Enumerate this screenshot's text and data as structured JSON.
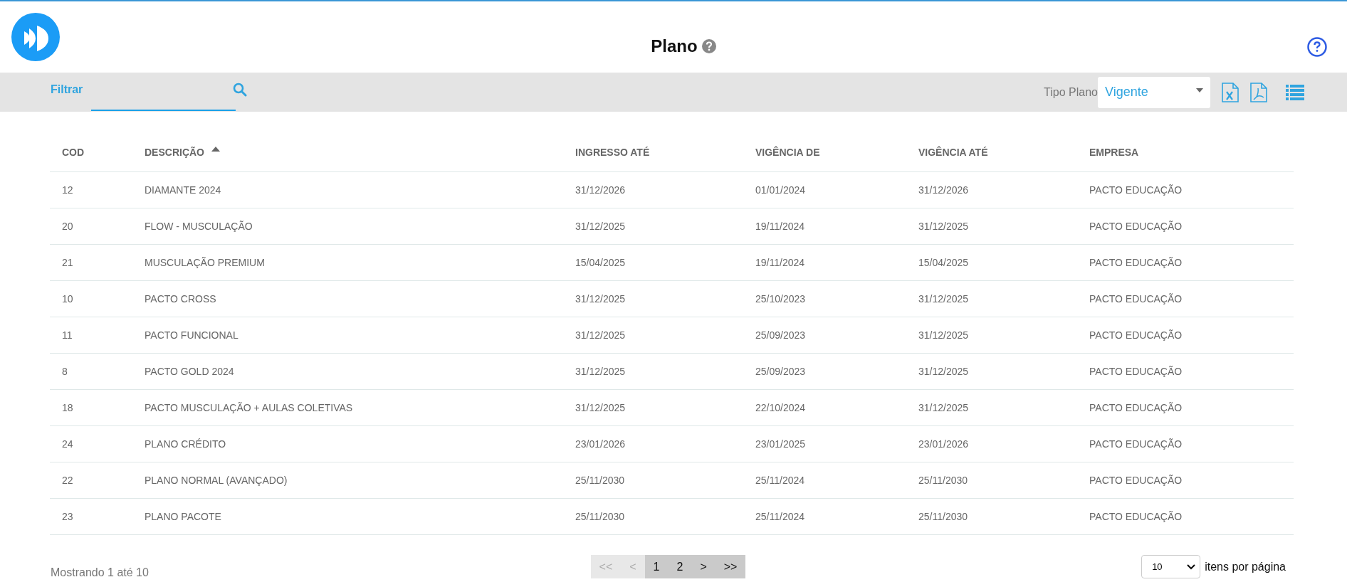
{
  "header": {
    "title": "Plano"
  },
  "filter_bar": {
    "filter_label": "Filtrar",
    "type_label": "Tipo Plano",
    "type_select": {
      "value": "Vigente"
    }
  },
  "table": {
    "columns": [
      {
        "label": "COD",
        "sorted": false
      },
      {
        "label": "DESCRIÇÃO",
        "sorted": true
      },
      {
        "label": "INGRESSO ATÉ",
        "sorted": false
      },
      {
        "label": "VIGÊNCIA DE",
        "sorted": false
      },
      {
        "label": "VIGÊNCIA ATÉ",
        "sorted": false
      },
      {
        "label": "EMPRESA",
        "sorted": false
      }
    ],
    "rows": [
      [
        "12",
        "DIAMANTE 2024",
        "31/12/2026",
        "01/01/2024",
        "31/12/2026",
        "PACTO EDUCAÇÃO"
      ],
      [
        "20",
        "FLOW - MUSCULAÇÃO",
        "31/12/2025",
        "19/11/2024",
        "31/12/2025",
        "PACTO EDUCAÇÃO"
      ],
      [
        "21",
        "MUSCULAÇÃO PREMIUM",
        "15/04/2025",
        "19/11/2024",
        "15/04/2025",
        "PACTO EDUCAÇÃO"
      ],
      [
        "10",
        "PACTO CROSS",
        "31/12/2025",
        "25/10/2023",
        "31/12/2025",
        "PACTO EDUCAÇÃO"
      ],
      [
        "11",
        "PACTO FUNCIONAL",
        "31/12/2025",
        "25/09/2023",
        "31/12/2025",
        "PACTO EDUCAÇÃO"
      ],
      [
        "8",
        "PACTO GOLD 2024",
        "31/12/2025",
        "25/09/2023",
        "31/12/2025",
        "PACTO EDUCAÇÃO"
      ],
      [
        "18",
        "PACTO MUSCULAÇÃO + AULAS COLETIVAS",
        "31/12/2025",
        "22/10/2024",
        "31/12/2025",
        "PACTO EDUCAÇÃO"
      ],
      [
        "24",
        "PLANO CRÉDITO",
        "23/01/2026",
        "23/01/2025",
        "23/01/2026",
        "PACTO EDUCAÇÃO"
      ],
      [
        "22",
        "PLANO NORMAL (AVANÇADO)",
        "25/11/2030",
        "25/11/2024",
        "25/11/2030",
        "PACTO EDUCAÇÃO"
      ],
      [
        "23",
        "PLANO PACOTE",
        "25/11/2030",
        "25/11/2024",
        "25/11/2030",
        "PACTO EDUCAÇÃO"
      ]
    ]
  },
  "footer": {
    "summary": "Mostrando 1 até 10",
    "pagination": [
      {
        "label": "<<",
        "disabled": true
      },
      {
        "label": "<",
        "disabled": true
      },
      {
        "label": "1",
        "disabled": false
      },
      {
        "label": "2",
        "disabled": false
      },
      {
        "label": ">",
        "disabled": false
      },
      {
        "label": ">>",
        "disabled": false
      }
    ],
    "page_size": {
      "value": "10"
    },
    "page_size_label": "itens por página"
  }
}
